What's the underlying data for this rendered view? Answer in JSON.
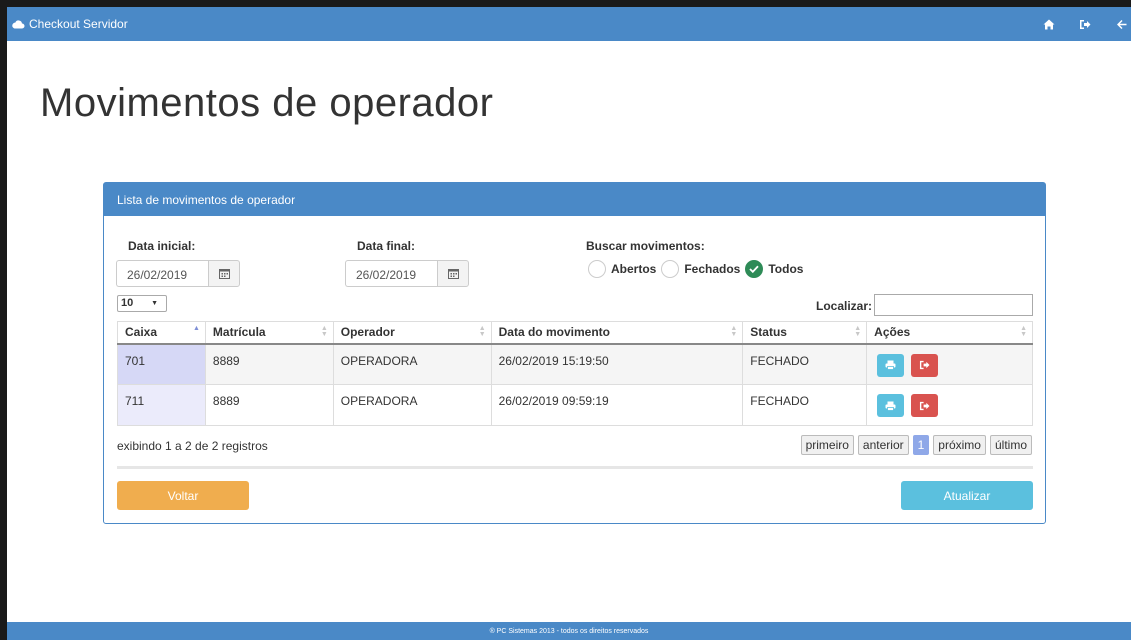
{
  "app": {
    "title": "Checkout Servidor"
  },
  "page": {
    "title": "Movimentos de operador"
  },
  "panel": {
    "title": "Lista de movimentos de operador"
  },
  "filters": {
    "start_label": "Data inicial:",
    "start_value": "26/02/2019",
    "end_label": "Data final:",
    "end_value": "26/02/2019",
    "search_label": "Buscar movimentos:",
    "options": [
      {
        "label": "Abertos",
        "checked": false
      },
      {
        "label": "Fechados",
        "checked": false
      },
      {
        "label": "Todos",
        "checked": true
      }
    ]
  },
  "table": {
    "page_size": "10",
    "search_label": "Localizar:",
    "search_value": "",
    "columns": [
      "Caixa",
      "Matrícula",
      "Operador",
      "Data do movimento",
      "Status",
      "Ações"
    ],
    "rows": [
      {
        "caixa": "701",
        "matricula": "8889",
        "operador": "OPERADORA",
        "data": "26/02/2019 15:19:50",
        "status": "FECHADO"
      },
      {
        "caixa": "711",
        "matricula": "8889",
        "operador": "OPERADORA",
        "data": "26/02/2019 09:59:19",
        "status": "FECHADO"
      }
    ],
    "info": "exibindo 1 a 2 de 2 registros"
  },
  "pagination": {
    "first": "primeiro",
    "prev": "anterior",
    "current": "1",
    "next": "próximo",
    "last": "último"
  },
  "buttons": {
    "back": "Voltar",
    "refresh": "Atualizar"
  },
  "footer": {
    "text": "® PC Sistemas 2013 - todos os direitos reservados"
  },
  "colors": {
    "primary": "#4a89c7",
    "warning": "#f0ad4e",
    "info": "#5bc0de",
    "danger": "#d9534f",
    "success": "#2e8b57"
  }
}
